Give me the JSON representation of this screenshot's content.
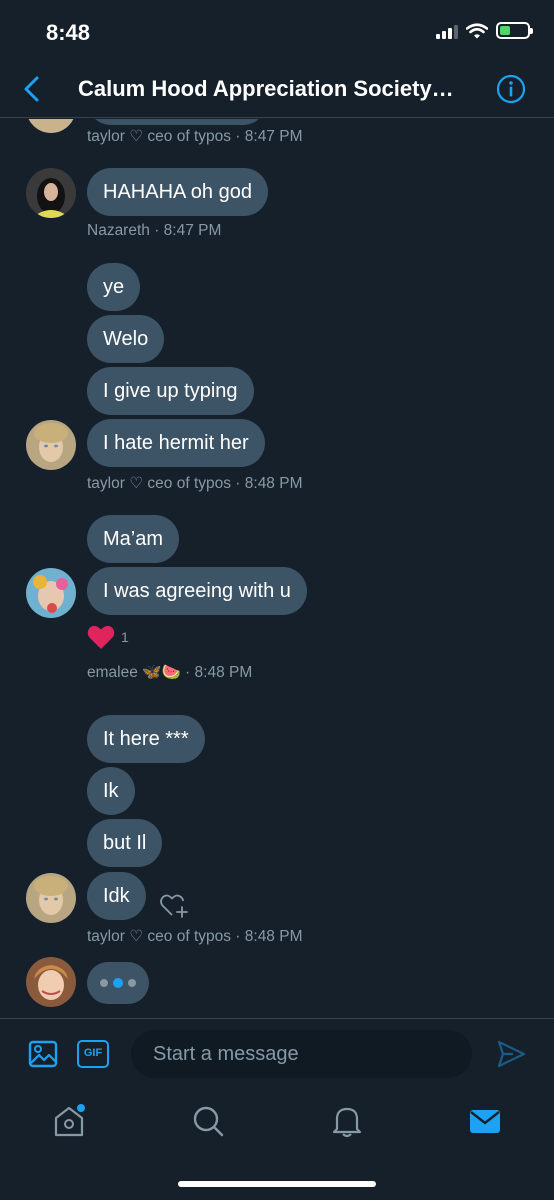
{
  "status_bar": {
    "time": "8:48"
  },
  "header": {
    "title": "Calum Hood Appreciation Society…"
  },
  "messages": {
    "m0": {
      "meta": "taylor ♡ ceo of typos · 8:47 PM"
    },
    "m1": {
      "text": "HAHAHA oh god",
      "meta": "Nazareth · 8:47 PM"
    },
    "m2": {
      "b1": "ye",
      "b2": "Welo",
      "b3": "I give up typing",
      "b4": "I hate hermit her",
      "meta": "taylor ♡ ceo of typos · 8:48 PM"
    },
    "m3": {
      "b1": "Ma’am",
      "b2": "I was agreeing with u",
      "reaction_count": "1",
      "meta": "emalee 🦋🍉 · 8:48 PM"
    },
    "m4": {
      "b1": "It here ***",
      "b2": "Ik",
      "b3": "but Il",
      "b4": "Idk",
      "meta": "taylor ♡ ceo of typos · 8:48 PM"
    }
  },
  "composer": {
    "placeholder": "Start a message",
    "gif_label": "GIF"
  },
  "colors": {
    "accent": "#1da1f2",
    "background": "#15202b",
    "bubble": "#3d5466",
    "muted": "#8899a6",
    "heart": "#e0245e"
  }
}
